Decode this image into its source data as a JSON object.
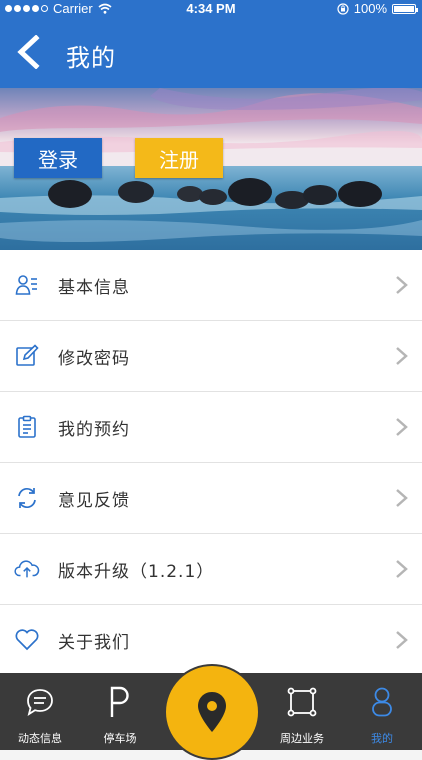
{
  "status_bar": {
    "carrier": "Carrier",
    "time": "4:34 PM",
    "battery": "100%"
  },
  "nav": {
    "title": "我的"
  },
  "banner": {
    "login_label": "登录",
    "register_label": "注册"
  },
  "menu": [
    {
      "label": "基本信息",
      "icon": "user-info-icon"
    },
    {
      "label": "修改密码",
      "icon": "edit-icon"
    },
    {
      "label": "我的预约",
      "icon": "clipboard-icon"
    },
    {
      "label": "意见反馈",
      "icon": "refresh-icon"
    },
    {
      "label": "版本升级（1.2.1）",
      "icon": "cloud-upload-icon"
    },
    {
      "label": "关于我们",
      "icon": "heart-icon"
    }
  ],
  "tabs": [
    {
      "label": "动态信息",
      "icon": "chat-bubble-icon"
    },
    {
      "label": "停车场",
      "icon": "parking-icon"
    },
    {
      "label": "",
      "icon": "location-pin-icon"
    },
    {
      "label": "周边业务",
      "icon": "square-nodes-icon"
    },
    {
      "label": "我的",
      "icon": "person-icon",
      "active": true
    }
  ],
  "colors": {
    "primary": "#2c72cb",
    "accent": "#f4b919",
    "tabbar": "#3a3a3a",
    "active_tab": "#3d8ae6"
  }
}
